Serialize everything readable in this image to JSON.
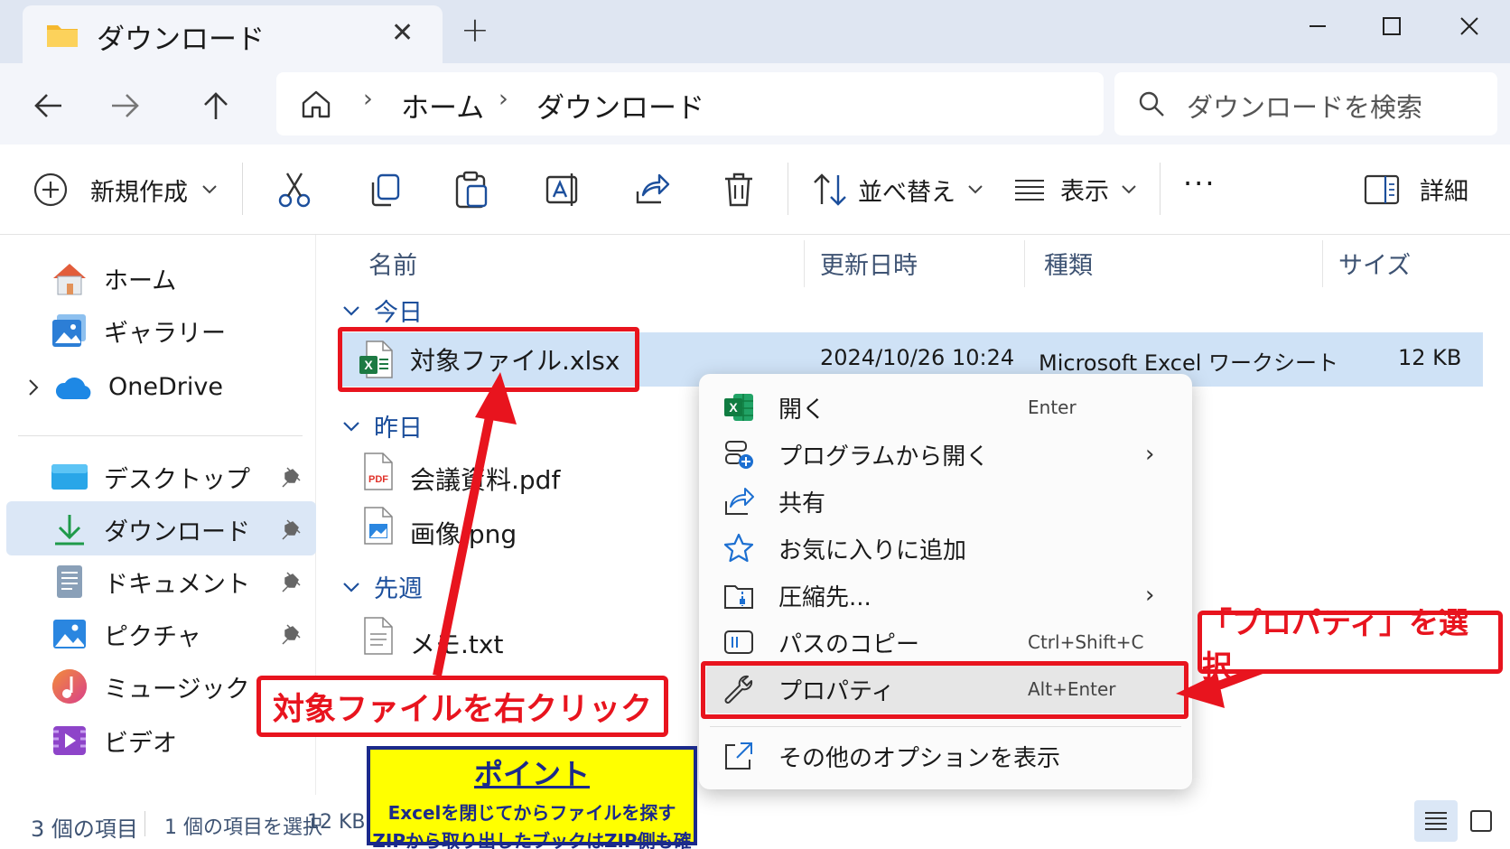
{
  "window": {
    "tab_title": "ダウンロード",
    "tab_close": "✕",
    "new_tab": "+"
  },
  "address": {
    "crumbs": [
      "ホーム",
      "ダウンロード"
    ],
    "separator": "›",
    "search_placeholder": "ダウンロードを検索"
  },
  "toolbar": {
    "new_label": "新規作成",
    "sort_label": "並べ替え",
    "view_label": "表示",
    "more_label": "···",
    "details_label": "詳細"
  },
  "sidebar": {
    "top": [
      {
        "label": "ホーム",
        "icon": "home-icon"
      },
      {
        "label": "ギャラリー",
        "icon": "gallery-icon"
      },
      {
        "label": "OneDrive",
        "icon": "onedrive-icon"
      }
    ],
    "pinned": [
      {
        "label": "デスクトップ",
        "icon": "desktop-icon"
      },
      {
        "label": "ダウンロード",
        "icon": "download-icon"
      },
      {
        "label": "ドキュメント",
        "icon": "document-icon"
      },
      {
        "label": "ピクチャ",
        "icon": "picture-icon"
      },
      {
        "label": "ミュージック",
        "icon": "music-icon"
      },
      {
        "label": "ビデオ",
        "icon": "video-icon"
      }
    ]
  },
  "columns": {
    "name": "名前",
    "modified": "更新日時",
    "type": "種類",
    "size": "サイズ"
  },
  "groups": [
    {
      "label": "今日",
      "files": [
        {
          "name": "対象ファイル.xlsx",
          "modified": "2024/10/26 10:24",
          "type": "Microsoft Excel ワークシート",
          "size": "12 KB",
          "icon": "excel-file-icon"
        }
      ]
    },
    {
      "label": "昨日",
      "files": [
        {
          "name": "会議資料.pdf",
          "icon": "pdf-file-icon"
        },
        {
          "name": "画像.png",
          "icon": "image-file-icon"
        }
      ]
    },
    {
      "label": "先週",
      "files": [
        {
          "name": "メモ.txt",
          "icon": "text-file-icon"
        }
      ]
    }
  ],
  "context_menu": {
    "items": [
      {
        "label": "開く",
        "shortcut": "Enter",
        "icon": "excel-icon"
      },
      {
        "label": "プログラムから開く",
        "arrow": "›",
        "icon": "open-with-icon"
      },
      {
        "label": "共有",
        "icon": "share-icon"
      },
      {
        "label": "お気に入りに追加",
        "icon": "star-icon"
      },
      {
        "label": "圧縮先...",
        "arrow": "›",
        "icon": "zip-icon"
      },
      {
        "label": "パスのコピー",
        "shortcut": "Ctrl+Shift+C",
        "icon": "copy-path-icon"
      },
      {
        "label": "プロパティ",
        "shortcut": "Alt+Enter",
        "icon": "wrench-icon"
      },
      {
        "label": "その他のオプションを表示",
        "icon": "more-options-icon"
      }
    ]
  },
  "status": {
    "count": "3 個の項目",
    "selected": "1 個の項目を選択",
    "size": "12 KB"
  },
  "annotations": {
    "right_click": "対象ファイルを右クリック",
    "properties": "「プロパティ」を選択",
    "point_title": "ポイント",
    "point_line1": "Excelを閉じてからファイルを探す",
    "point_line2": "ZIPから取り出したブックはZIP側も確認"
  },
  "colors": {
    "accent": "#1c4f9c",
    "annotation_red": "#e8141e",
    "selection": "#cfe2f6",
    "point_bg": "#ffff00",
    "point_text": "#1b2a8a"
  }
}
